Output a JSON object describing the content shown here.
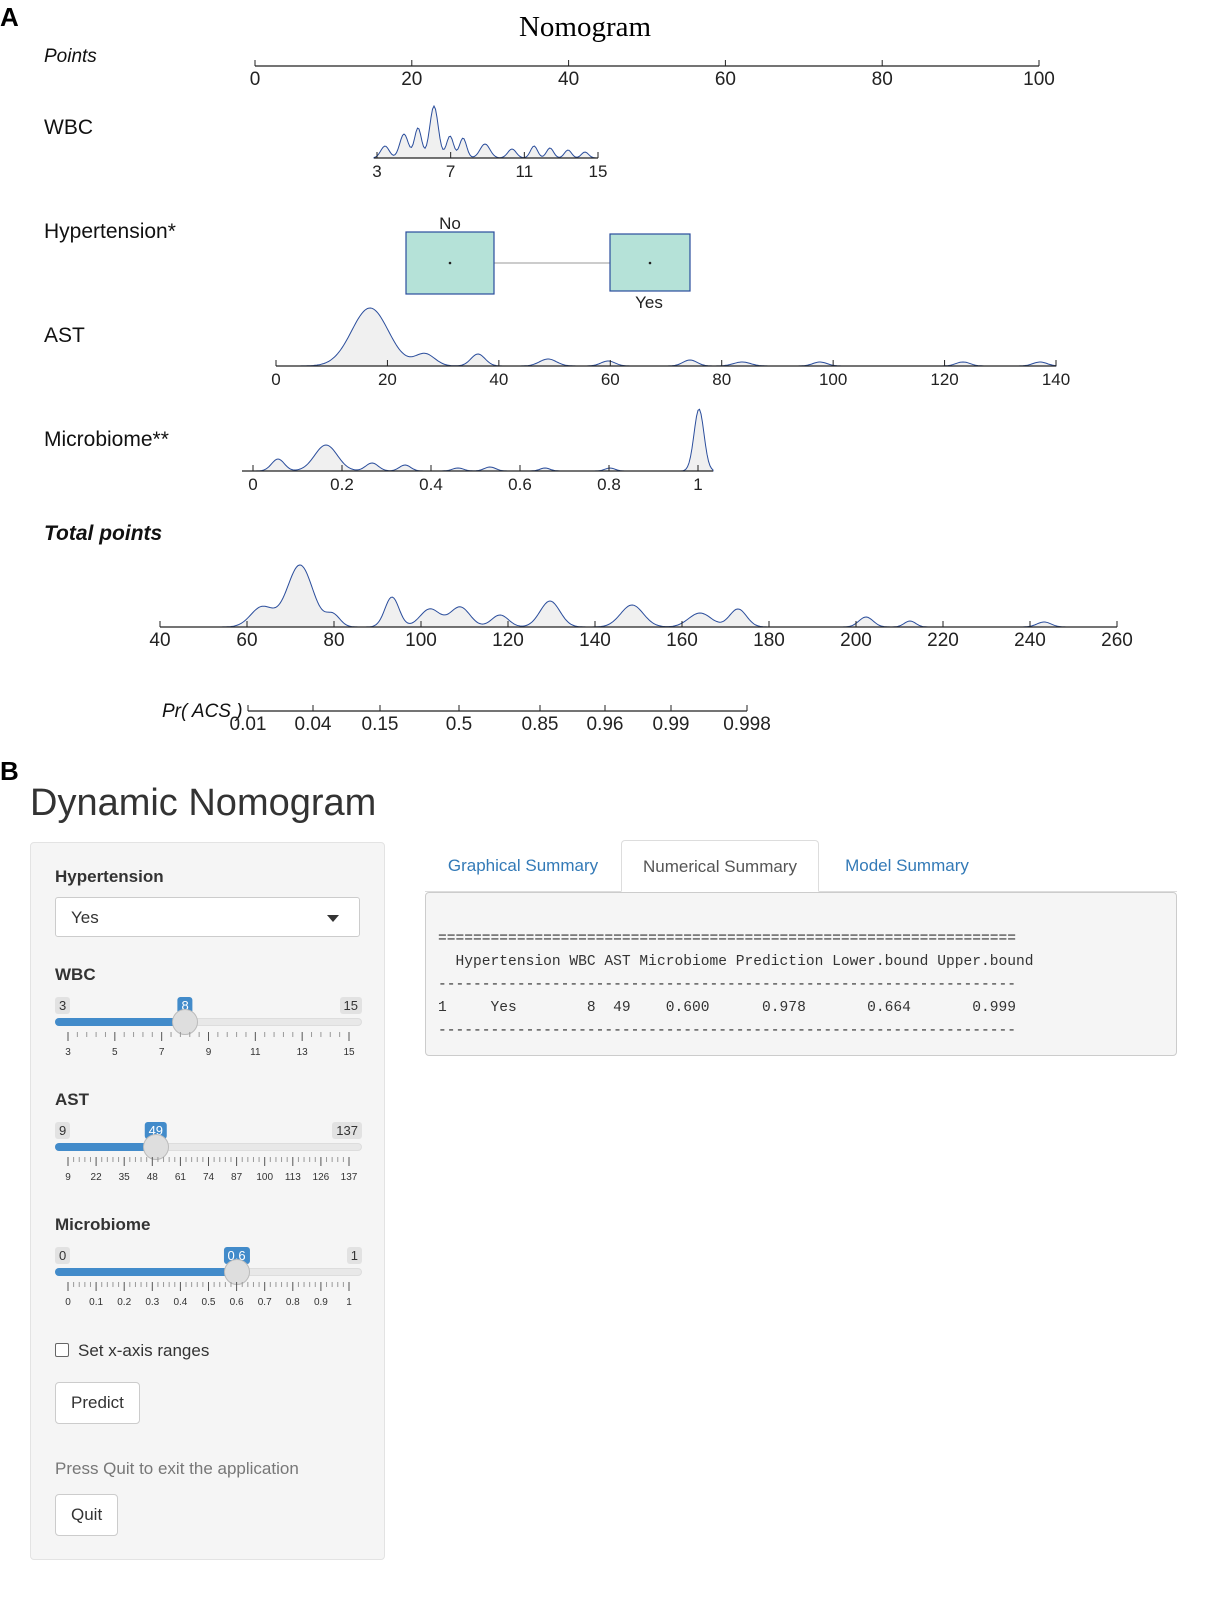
{
  "panel_labels": {
    "a": "A",
    "b": "B"
  },
  "chart_data": {
    "type": "nomogram",
    "title": "Nomogram",
    "scales": [
      {
        "name": "Points",
        "ticks": [
          "0",
          "20",
          "40",
          "60",
          "80",
          "100"
        ]
      },
      {
        "name": "WBC",
        "ticks": [
          "3",
          "7",
          "11",
          "15"
        ],
        "range": [
          3,
          15
        ]
      },
      {
        "name": "Hypertension*",
        "levels": [
          "No",
          "Yes"
        ]
      },
      {
        "name": "AST",
        "ticks": [
          "0",
          "20",
          "40",
          "60",
          "80",
          "100",
          "120",
          "140"
        ],
        "range": [
          0,
          140
        ]
      },
      {
        "name": "Microbiome**",
        "ticks": [
          "0",
          "0.2",
          "0.4",
          "0.6",
          "0.8",
          "1"
        ],
        "range": [
          0,
          1
        ]
      },
      {
        "name": "Total points",
        "ticks": [
          "40",
          "60",
          "80",
          "100",
          "120",
          "140",
          "160",
          "180",
          "200",
          "220",
          "240",
          "260"
        ],
        "range": [
          40,
          260
        ]
      },
      {
        "name": "Pr( ACS )",
        "ticks": [
          "0.01",
          "0.04",
          "0.15",
          "0.5",
          "0.85",
          "0.96",
          "0.99",
          "0.998"
        ]
      }
    ]
  },
  "app": {
    "title": "Dynamic Nomogram",
    "hypertension": {
      "label": "Hypertension",
      "value": "Yes"
    },
    "wbc": {
      "label": "WBC",
      "min": "3",
      "max": "15",
      "value": "8",
      "ticks": [
        "3",
        "5",
        "7",
        "9",
        "11",
        "13",
        "15"
      ]
    },
    "ast": {
      "label": "AST",
      "min": "9",
      "max": "137",
      "value": "49",
      "ticks": [
        "9",
        "22",
        "35",
        "48",
        "61",
        "74",
        "87",
        "100",
        "113",
        "126",
        "137"
      ]
    },
    "microbiome": {
      "label": "Microbiome",
      "min": "0",
      "max": "1",
      "value": "0.6",
      "ticks": [
        "0",
        "0.1",
        "0.2",
        "0.3",
        "0.4",
        "0.5",
        "0.6",
        "0.7",
        "0.8",
        "0.9",
        "1"
      ]
    },
    "checkbox_label": "Set x-axis ranges",
    "predict_label": "Predict",
    "quit_text": "Press Quit to exit the application",
    "quit_label": "Quit",
    "tabs": [
      "Graphical Summary",
      "Numerical Summary",
      "Model Summary"
    ],
    "active_tab": "Numerical Summary",
    "output_lines": [
      "==================================================================",
      "  Hypertension WBC AST Microbiome Prediction Lower.bound Upper.bound",
      "------------------------------------------------------------------",
      "1     Yes        8  49    0.600      0.978       0.664       0.999",
      "------------------------------------------------------------------"
    ],
    "accent_color": "#428bca"
  }
}
